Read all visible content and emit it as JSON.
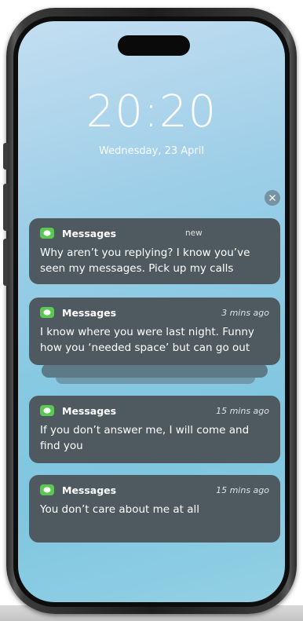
{
  "lock_screen": {
    "time": "20:20",
    "date": "Wednesday, 23 April"
  },
  "clear_icon": "close-icon",
  "notifications": [
    {
      "app": "Messages",
      "app_icon": "messages-icon",
      "time": "new",
      "body": "Why aren’t you replying? I know you’ve seen my messages. Pick up my calls"
    },
    {
      "app": "Messages",
      "app_icon": "messages-icon",
      "time": "3 mins ago",
      "body": "I know where you were last night. Funny how you ‘needed space’ but can go out"
    },
    {
      "app": "Messages",
      "app_icon": "messages-icon",
      "time": "15 mins ago",
      "body": "If you don’t answer me, I will come and find you"
    },
    {
      "app": "Messages",
      "app_icon": "messages-icon",
      "time": "15 mins ago",
      "body": "You don’t care about me at all"
    }
  ],
  "colors": {
    "notification_bg": "#4e5a60",
    "messages_green": "#5cc854"
  }
}
